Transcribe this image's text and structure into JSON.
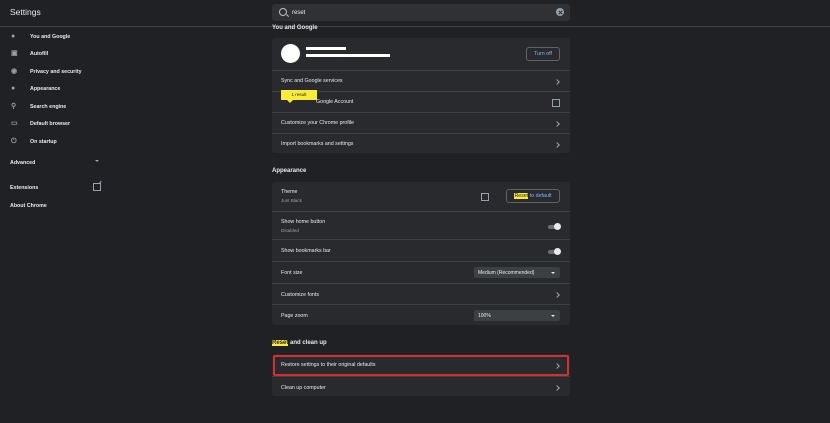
{
  "header": {
    "title": "Settings",
    "search_value": "reset"
  },
  "sidebar": {
    "items": [
      {
        "label": "You and Google",
        "icon": "person-icon"
      },
      {
        "label": "Autofill",
        "icon": "clipboard-icon"
      },
      {
        "label": "Privacy and security",
        "icon": "shield-icon"
      },
      {
        "label": "Appearance",
        "icon": "palette-icon"
      },
      {
        "label": "Search engine",
        "icon": "search-icon"
      },
      {
        "label": "Default browser",
        "icon": "browser-icon"
      },
      {
        "label": "On startup",
        "icon": "power-icon"
      }
    ],
    "advanced": "Advanced",
    "extensions": "Extensions",
    "about": "About Chrome"
  },
  "you_and_google": {
    "title": "You and Google",
    "turn_off": "Turn off",
    "rows": [
      "Sync and Google services",
      "Manage your Google Account",
      "Customize your Chrome profile",
      "Import bookmarks and settings"
    ],
    "manage_visible": "Google Account",
    "result_bubble": "1 result"
  },
  "appearance": {
    "title": "Appearance",
    "theme_label": "Theme",
    "theme_value": "Just Black",
    "reset_default_hl": "Reset",
    "reset_default_rest": " to default",
    "home_button_label": "Show home button",
    "home_button_value": "Disabled",
    "bookmarks_bar_label": "Show bookmarks bar",
    "font_size_label": "Font size",
    "font_size_value": "Medium (Recommended)",
    "customize_fonts_label": "Customize fonts",
    "page_zoom_label": "Page zoom",
    "page_zoom_value": "100%"
  },
  "reset_section": {
    "title_hl": "Reset",
    "title_rest": " and clean up",
    "rows": [
      "Restore settings to their original defaults",
      "Clean up computer"
    ]
  }
}
